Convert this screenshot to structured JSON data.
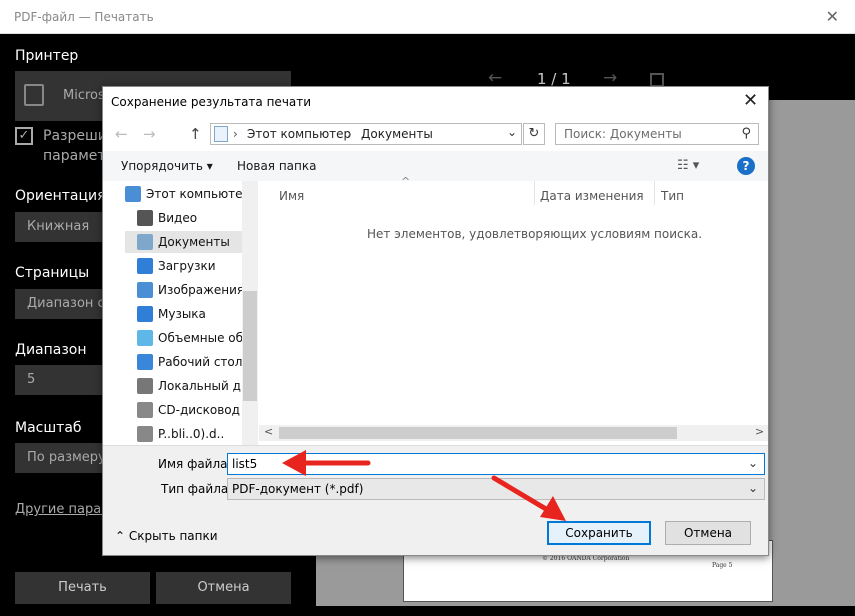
{
  "window": {
    "title": "PDF-файл — Печатать",
    "close_glyph": "✕"
  },
  "print_panel": {
    "printer_label": "Принтер",
    "printer_value": "Micros",
    "checkbox_label_line1": "Разреши",
    "checkbox_label_line2": "парамет",
    "orientation_label": "Ориентация",
    "orientation_value": "Книжная",
    "pages_label": "Страницы",
    "pages_value": "Диапазон ст",
    "range_label": "Диапазон",
    "range_value": "5",
    "scale_label": "Масштаб",
    "scale_value": "По размеру",
    "other_params_link": "Другие парам",
    "print_button": "Печать",
    "cancel_button": "Отмена"
  },
  "preview": {
    "prev_glyph": "←",
    "next_glyph": "→",
    "page_indicator": "1 / 1",
    "page_copyright": "© 2016 OANDA Corporation",
    "page_number": "Page 5"
  },
  "dialog": {
    "title": "Сохранение результата печати",
    "close_glyph": "✕",
    "nav": {
      "back": "←",
      "forward": "→",
      "up": "↑"
    },
    "address": {
      "segments": [
        "Этот компьютер",
        "Документы"
      ],
      "separator": "›",
      "dropdown": "⌄",
      "refresh": "↻"
    },
    "search": {
      "placeholder": "Поиск: Документы",
      "icon": "⚲"
    },
    "toolbar": {
      "organize": "Упорядочить ▾",
      "new_folder": "Новая папка",
      "view": "☷ ▾",
      "help": "?"
    },
    "nav_items": [
      {
        "label": "Этот компьютер",
        "icon": "computer-icon",
        "color": "#4a8fd6"
      },
      {
        "label": "Видео",
        "icon": "video-icon",
        "color": "#555555"
      },
      {
        "label": "Документы",
        "icon": "documents-icon",
        "color": "#7fa7cc"
      },
      {
        "label": "Загрузки",
        "icon": "downloads-icon",
        "color": "#2f7fd8"
      },
      {
        "label": "Изображения",
        "icon": "pictures-icon",
        "color": "#4a8fd6"
      },
      {
        "label": "Музыка",
        "icon": "music-icon",
        "color": "#2f7fd8"
      },
      {
        "label": "Объемные объ",
        "icon": "3d-objects-icon",
        "color": "#5fb7e8"
      },
      {
        "label": "Рабочий стол",
        "icon": "desktop-icon",
        "color": "#3a86d8"
      },
      {
        "label": "Локальный дис",
        "icon": "local-disk-icon",
        "color": "#777777"
      },
      {
        "label": "CD-дисковод (D",
        "icon": "cd-drive-icon",
        "color": "#888888"
      },
      {
        "label": "P..bli..0).d..",
        "icon": "network-icon",
        "color": "#888888"
      }
    ],
    "columns": [
      "Имя",
      "Дата изменения",
      "Тип"
    ],
    "sort_glyph": "^",
    "empty_message": "Нет элементов, удовлетворяющих условиям поиска.",
    "scroll_left": "<",
    "scroll_right": ">",
    "file_name_label": "Имя файла:",
    "file_name_value": "list5",
    "file_type_label": "Тип файла:",
    "file_type_value": "PDF-документ (*.pdf)",
    "dropdown_glyph": "⌄",
    "hide_folders": "⌃  Скрыть папки",
    "save_button": "Сохранить",
    "cancel_button": "Отмена"
  },
  "annotation_color": "#e8241f"
}
